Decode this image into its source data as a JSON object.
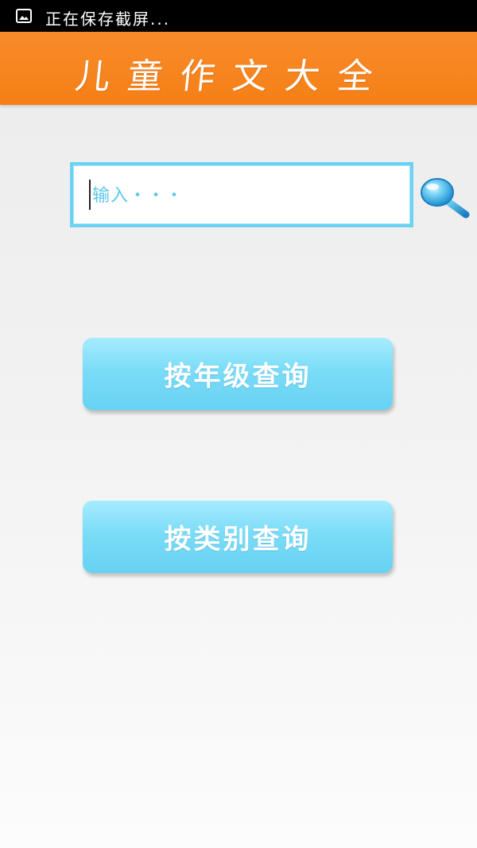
{
  "status_bar": {
    "icon": "image-icon",
    "text": "正在保存截屏..."
  },
  "header": {
    "title": "儿童作文大全",
    "background_color": "#f7821e"
  },
  "search": {
    "placeholder": "输入・・・",
    "value": "",
    "icon": "magnifier-icon",
    "border_color": "#6ad2f2"
  },
  "buttons": {
    "by_grade": "按年级查询",
    "by_category": "按类别查询",
    "color": "#72d8f5"
  }
}
